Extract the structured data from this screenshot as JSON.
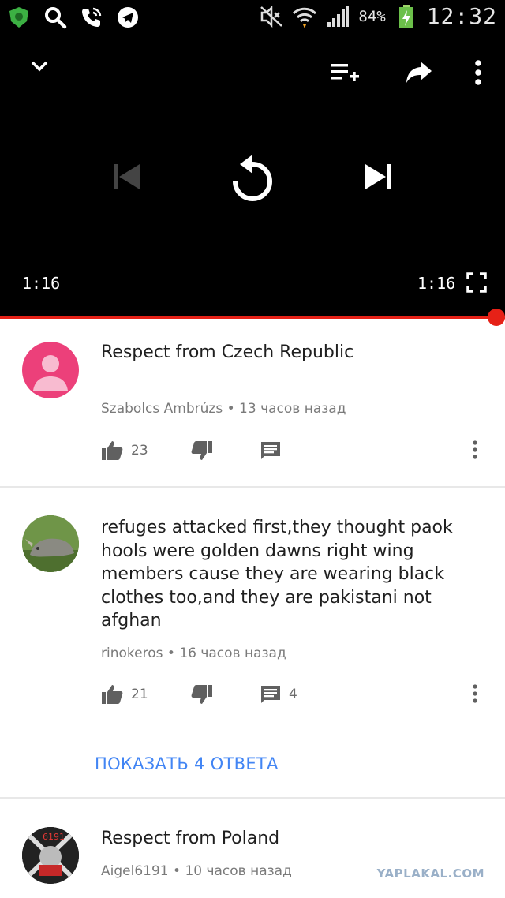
{
  "statusbar": {
    "battery_pct": "84%",
    "clock": "12:32",
    "left_icons": [
      "shield-icon",
      "search-icon",
      "phone-wifi-icon",
      "telegram-icon"
    ],
    "right_icons": [
      "mute-icon",
      "wifi-icon",
      "signal-icon",
      "battery-icon"
    ]
  },
  "player": {
    "current_time": "1:16",
    "duration": "1:16",
    "progress": 1.0,
    "accent": "#e62117"
  },
  "comments": [
    {
      "text": "Respect from Czech Republic",
      "author": "Szabolcs Ambrúzs",
      "time": "13 часов назад",
      "likes": "23",
      "reply_count": ""
    },
    {
      "text": "refuges attacked first,they thought paok hools were golden dawns right wing members cause they are wearing black clothes too,and they are pakistani not afghan",
      "author": "rinokeros",
      "time": "16 часов назад",
      "likes": "21",
      "reply_count": "4",
      "show_replies": "ПОКАЗАТЬ 4 ОТВЕТА"
    },
    {
      "text": "Respect from Poland",
      "author": "Aigel6191",
      "time": "10 часов назад"
    }
  ],
  "meta_separator": "•",
  "avatar3_text": "6191",
  "watermark": "YAPLAKAL.COM"
}
